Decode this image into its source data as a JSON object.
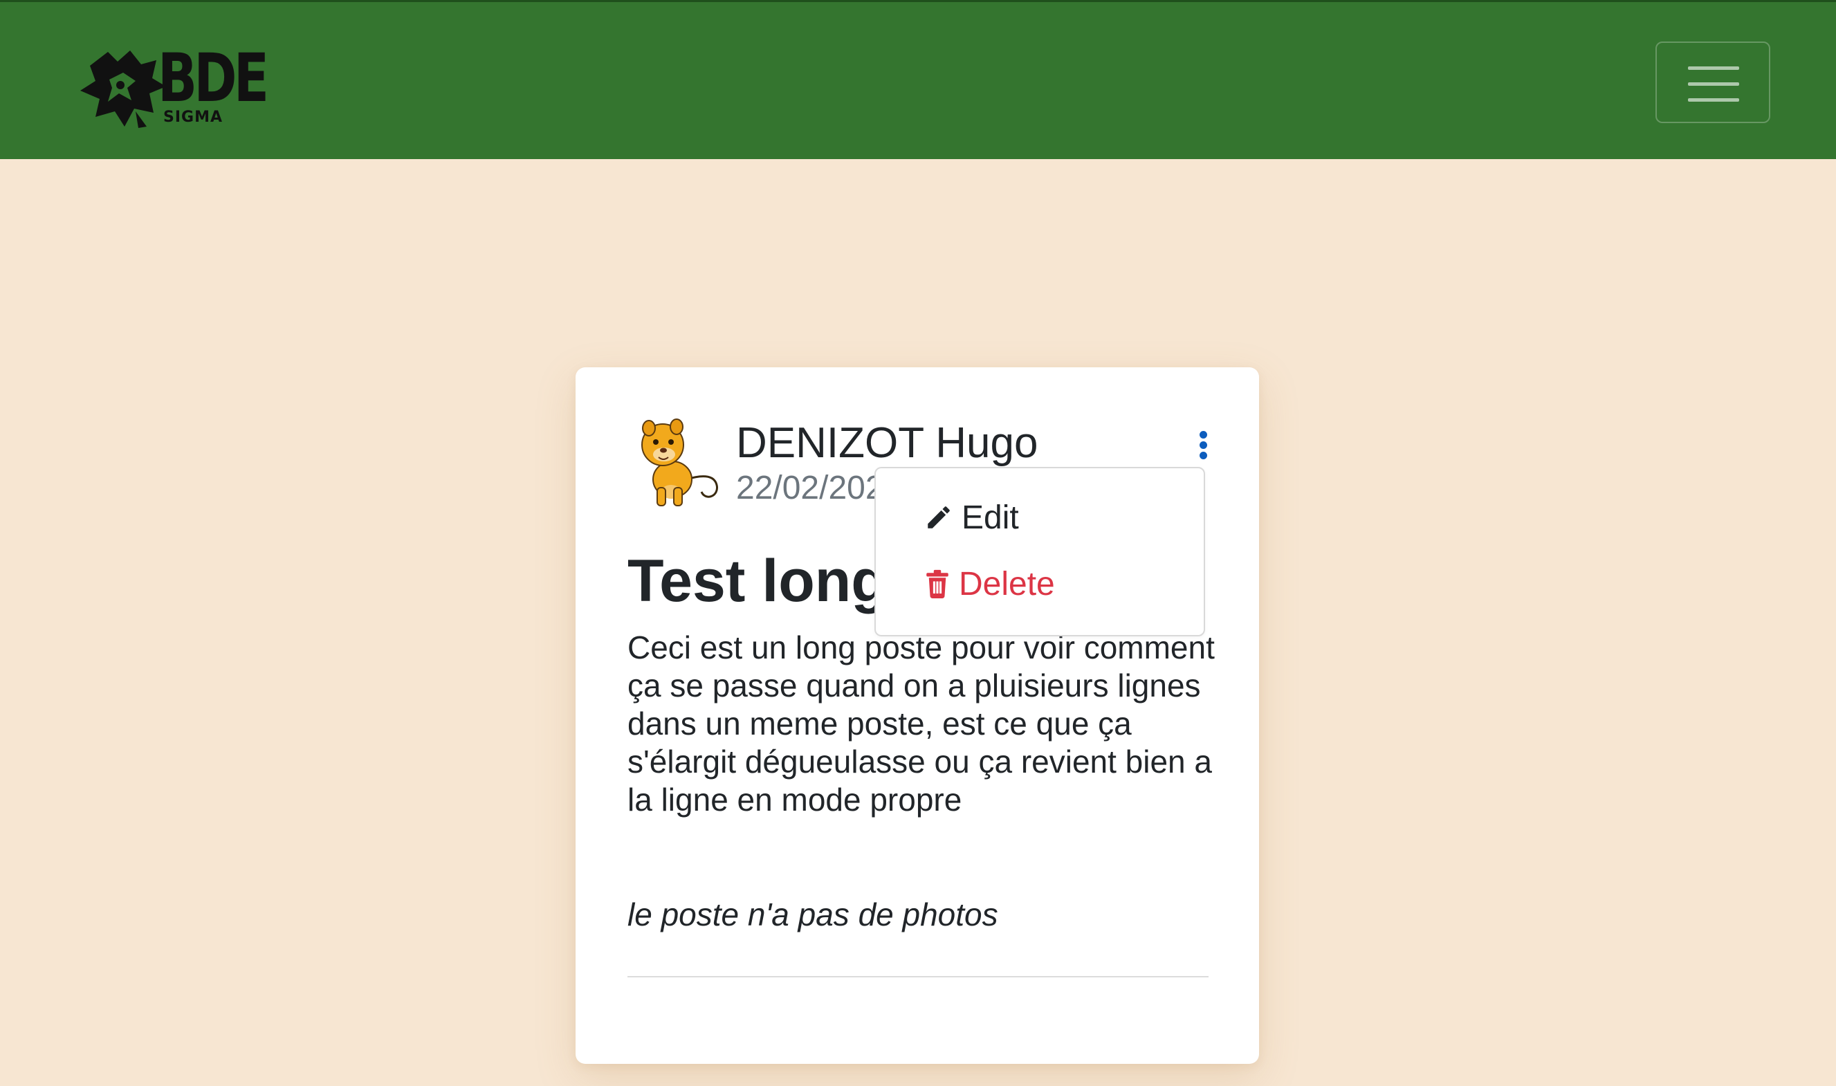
{
  "navbar": {
    "logo_text": "BDE",
    "logo_subtext": "SIGMA",
    "menu_icon": "hamburger-icon",
    "color": "#34752f"
  },
  "post": {
    "author": "DENIZOT Hugo",
    "date": "22/02/202",
    "avatar_icon": "lion-cub-avatar",
    "menu_icon": "vertical-ellipsis-icon",
    "title": "Test long",
    "body": "Ceci est un long poste pour voir comment ça se passe quand on a pluisieurs lignes dans un meme poste, est ce que ça s'élargit dégueulasse ou ça revient bien a la ligne en mode propre",
    "no_photos_text": "le poste n'a pas de photos"
  },
  "dropdown": {
    "edit_label": "Edit",
    "edit_icon": "pencil-icon",
    "delete_label": "Delete",
    "delete_icon": "trash-icon",
    "delete_color": "#dc3545"
  },
  "colors": {
    "page_background": "#f7e6d2",
    "accent_link": "#0d5dbd"
  }
}
